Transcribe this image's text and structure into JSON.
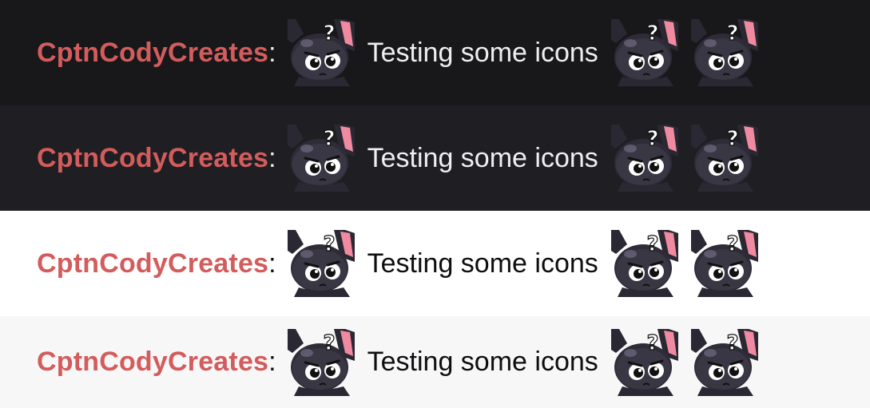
{
  "chat": {
    "messages": [
      {
        "theme": "dark",
        "username": "CptnCodyCreates",
        "separator": ":",
        "text": "Testing some icons",
        "emotes_before": [
          "question-bunny-emote"
        ],
        "emotes_after": [
          "question-bunny-emote",
          "question-bunny-emote"
        ]
      },
      {
        "theme": "dark",
        "username": "CptnCodyCreates",
        "separator": ":",
        "text": "Testing some icons",
        "emotes_before": [
          "question-bunny-emote"
        ],
        "emotes_after": [
          "question-bunny-emote",
          "question-bunny-emote"
        ]
      },
      {
        "theme": "light",
        "username": "CptnCodyCreates",
        "separator": ":",
        "text": "Testing some icons",
        "emotes_before": [
          "question-bunny-emote"
        ],
        "emotes_after": [
          "question-bunny-emote",
          "question-bunny-emote"
        ]
      },
      {
        "theme": "light",
        "username": "CptnCodyCreates",
        "separator": ":",
        "text": "Testing some icons",
        "emotes_before": [
          "question-bunny-emote"
        ],
        "emotes_after": [
          "question-bunny-emote",
          "question-bunny-emote"
        ]
      }
    ]
  },
  "colors": {
    "username": "#d35c5c",
    "dark_bg_1": "#18181b",
    "dark_bg_2": "#1f1f23",
    "light_bg_1": "#ffffff",
    "light_bg_2": "#f7f7f8"
  }
}
